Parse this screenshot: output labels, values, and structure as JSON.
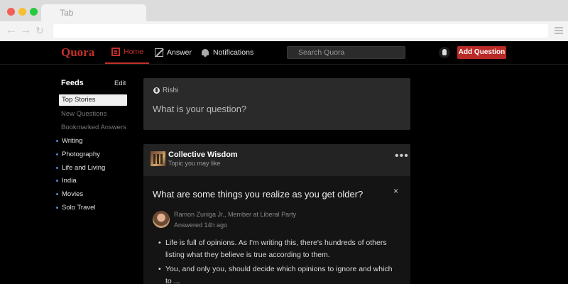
{
  "browser": {
    "tab_label": "Tab",
    "icons": {
      "back": "back-arrow-icon",
      "forward": "forward-arrow-icon",
      "reload": "reload-icon",
      "menu": "hamburger-menu-icon"
    }
  },
  "header": {
    "logo": "Quora",
    "nav": {
      "home": "Home",
      "answer": "Answer",
      "notifications": "Notifications"
    },
    "search_placeholder": "Search Quora",
    "add_question": "Add Question",
    "accent_color": "#b92b27"
  },
  "sidebar": {
    "title": "Feeds",
    "edit": "Edit",
    "feeds": [
      "Top Stories",
      "New Questions",
      "Bookmarked Answers"
    ],
    "topics": [
      "Writing",
      "Photography",
      "Life and Living",
      "India",
      "Movies",
      "Solo Travel"
    ]
  },
  "ask": {
    "user": "Rishi",
    "prompt": "What is your question?"
  },
  "feed": {
    "topic_name": "Collective Wisdom",
    "topic_sub": "Topic you may like",
    "question": "What are some things you realize as you get older?",
    "answerer": "Ramon Zuniga Jr., Member at Liberal Party",
    "answered": "Answered 14h ago",
    "bullets": [
      "Life is full of opinions. As I'm writing this, there's hundreds of others listing what they believe is true according to them.",
      "You, and only you, should decide which opinions to ignore and which to ..."
    ],
    "more": "•••",
    "close": "×"
  }
}
